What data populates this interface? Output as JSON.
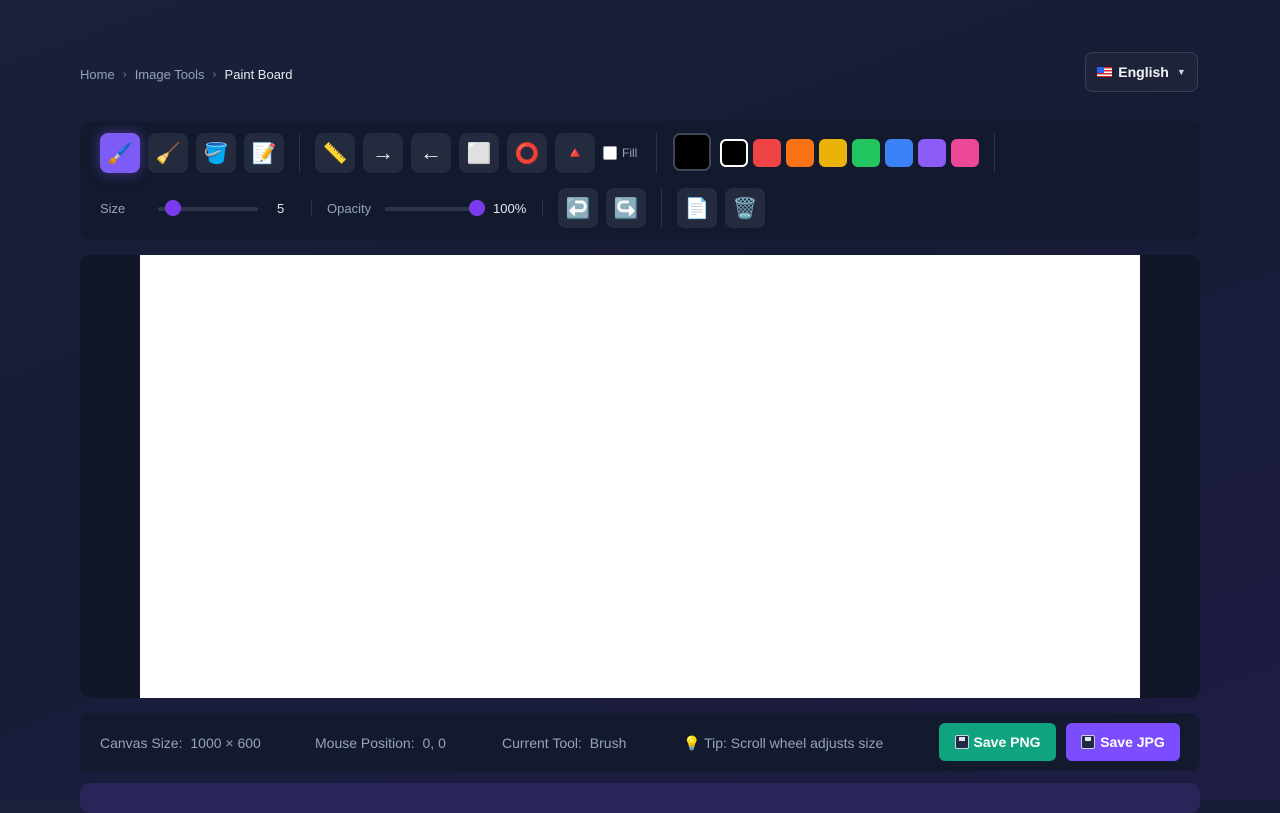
{
  "breadcrumb": {
    "items": [
      "Home",
      "Image Tools",
      "Paint Board"
    ],
    "separator": "›"
  },
  "language": {
    "label": "English",
    "flag_icon": "us-flag-icon",
    "caret": "▼"
  },
  "toolbar": {
    "tools": [
      {
        "name": "brush",
        "icon": "🖌️",
        "active": true
      },
      {
        "name": "eraser",
        "icon": "🧹",
        "active": false
      },
      {
        "name": "fill-bucket",
        "icon": "🪣",
        "active": false
      },
      {
        "name": "text",
        "icon": "📝",
        "active": false
      }
    ],
    "shapes": [
      {
        "name": "line",
        "icon": "📏"
      },
      {
        "name": "arrow-right",
        "icon": "→"
      },
      {
        "name": "arrow-left",
        "icon": "←"
      },
      {
        "name": "rectangle",
        "icon": "⬜"
      },
      {
        "name": "circle",
        "icon": "⭕"
      },
      {
        "name": "triangle",
        "icon": "🔺"
      }
    ],
    "fill_label": "Fill",
    "fill_checked": false,
    "current_color": "#000000",
    "palette": [
      "#000000",
      "#ef4444",
      "#f97316",
      "#eab308",
      "#22c55e",
      "#3b82f6",
      "#8b5cf6",
      "#ec4899"
    ],
    "selected_palette_index": 0,
    "size_label": "Size",
    "size_value": "5",
    "size_level": 0.15,
    "opacity_label": "Opacity",
    "opacity_value": "100%",
    "opacity_level": 1.0,
    "actions": [
      {
        "name": "undo",
        "icon": "↩️"
      },
      {
        "name": "redo",
        "icon": "↪️"
      },
      {
        "name": "new-page",
        "icon": "📄"
      },
      {
        "name": "clear-trash",
        "icon": "🗑️"
      }
    ]
  },
  "status": {
    "canvas_size_label": "Canvas Size:",
    "canvas_size_value": "1000 × 600",
    "mouse_position_label": "Mouse Position:",
    "mouse_position_value": "0, 0",
    "current_tool_label": "Current Tool:",
    "current_tool_value": "Brush",
    "tip": "💡 Tip: Scroll wheel adjusts size",
    "save_png_label": "Save PNG",
    "save_jpg_label": "Save JPG",
    "save_png_color": "#10a37f",
    "save_jpg_color": "#7c4dff"
  }
}
